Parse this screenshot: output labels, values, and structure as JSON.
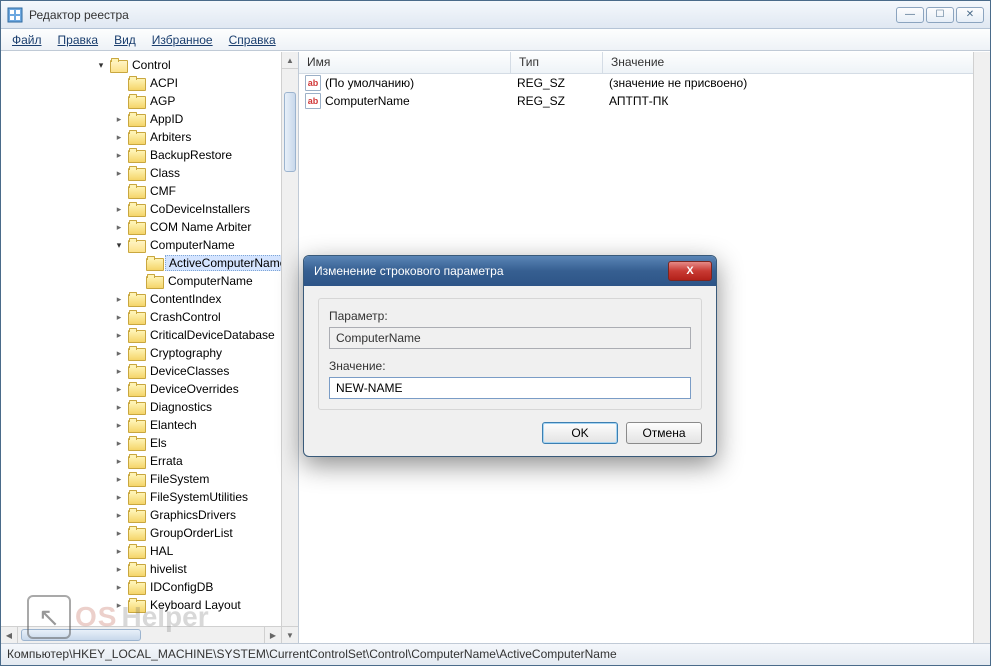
{
  "window": {
    "title": "Редактор реестра"
  },
  "menu": {
    "file": "Файл",
    "edit": "Правка",
    "view": "Вид",
    "fav": "Избранное",
    "help": "Справка"
  },
  "tree": {
    "root": "Control",
    "items": [
      "ACPI",
      "AGP",
      "AppID",
      "Arbiters",
      "BackupRestore",
      "Class",
      "CMF",
      "CoDeviceInstallers",
      "COM Name Arbiter"
    ],
    "cn": "ComputerName",
    "cn_children": [
      "ActiveComputerName",
      "ComputerName"
    ],
    "items2": [
      "ContentIndex",
      "CrashControl",
      "CriticalDeviceDatabase",
      "Cryptography",
      "DeviceClasses",
      "DeviceOverrides",
      "Diagnostics",
      "Elantech",
      "Els",
      "Errata",
      "FileSystem",
      "FileSystemUtilities",
      "GraphicsDrivers",
      "GroupOrderList",
      "HAL",
      "hivelist",
      "IDConfigDB",
      "Keyboard Layout"
    ]
  },
  "list": {
    "cols": {
      "name": "Имя",
      "type": "Тип",
      "value": "Значение"
    },
    "rows": [
      {
        "name": "(По умолчанию)",
        "type": "REG_SZ",
        "value": "(значение не присвоено)"
      },
      {
        "name": "ComputerName",
        "type": "REG_SZ",
        "value": "АПТПТ-ПК"
      }
    ]
  },
  "dialog": {
    "title": "Изменение строкового параметра",
    "param_label": "Параметр:",
    "param_value": "ComputerName",
    "value_label": "Значение:",
    "value_input": "NEW-NAME",
    "ok": "OK",
    "cancel": "Отмена"
  },
  "statusbar": "Компьютер\\HKEY_LOCAL_MACHINE\\SYSTEM\\CurrentControlSet\\Control\\ComputerName\\ActiveComputerName",
  "watermark": {
    "a": "OS",
    "b": "Helper"
  }
}
